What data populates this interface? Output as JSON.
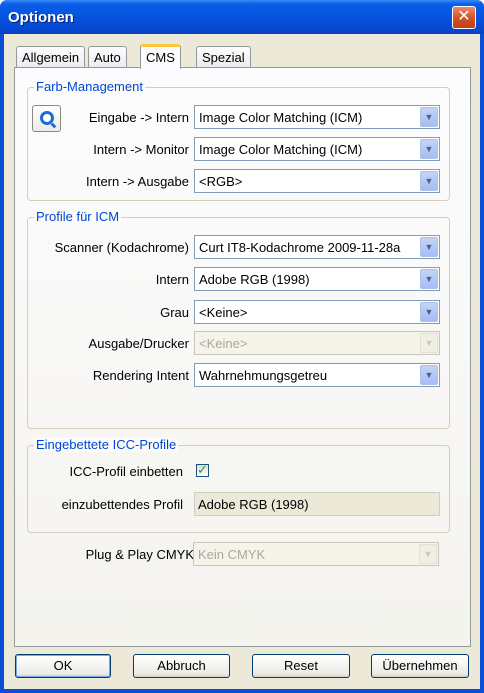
{
  "window": {
    "title": "Optionen",
    "close_symbol": "✕"
  },
  "tabs": [
    {
      "label": "Allgemein",
      "active": false
    },
    {
      "label": "Auto",
      "active": false
    },
    {
      "label": "CMS",
      "active": true
    },
    {
      "label": "Spezial",
      "active": false
    }
  ],
  "farb_management": {
    "title": "Farb-Management",
    "icon": "color-wheel-icon",
    "rows": [
      {
        "label": "Eingabe -> Intern",
        "value": "Image Color Matching (ICM)"
      },
      {
        "label": "Intern -> Monitor",
        "value": "Image Color Matching (ICM)"
      },
      {
        "label": "Intern -> Ausgabe",
        "value": "<RGB>"
      }
    ]
  },
  "profile_icm": {
    "title": "Profile für ICM",
    "rows": [
      {
        "label": "Scanner (Kodachrome)",
        "value": "Curt IT8-Kodachrome 2009-11-28a",
        "disabled": false
      },
      {
        "label": "Intern",
        "value": "Adobe RGB (1998)",
        "disabled": false
      },
      {
        "label": "Grau",
        "value": "<Keine>",
        "disabled": false
      },
      {
        "label": "Ausgabe/Drucker",
        "value": "<Keine>",
        "disabled": true
      },
      {
        "label": "Rendering Intent",
        "value": "Wahrnehmungsgetreu",
        "disabled": false
      }
    ]
  },
  "icc_embed": {
    "title": "Eingebettete ICC-Profile",
    "embed_label": "ICC-Profil einbetten",
    "embed_checked": true,
    "embed_check_mark": "✓",
    "profile_label": "einzubettendes Profil",
    "profile_value": "Adobe RGB (1998)"
  },
  "plug_play": {
    "label": "Plug & Play CMYK",
    "value": "Kein CMYK",
    "disabled": true
  },
  "buttons": {
    "ok": "OK",
    "cancel": "Abbruch",
    "reset": "Reset",
    "apply": "Übernehmen"
  },
  "colors": {
    "title_bar": "#0653de",
    "group_title": "#0046d5",
    "tab_highlight": "#ffc83c",
    "check": "#21a121",
    "close": "#d6532a"
  }
}
